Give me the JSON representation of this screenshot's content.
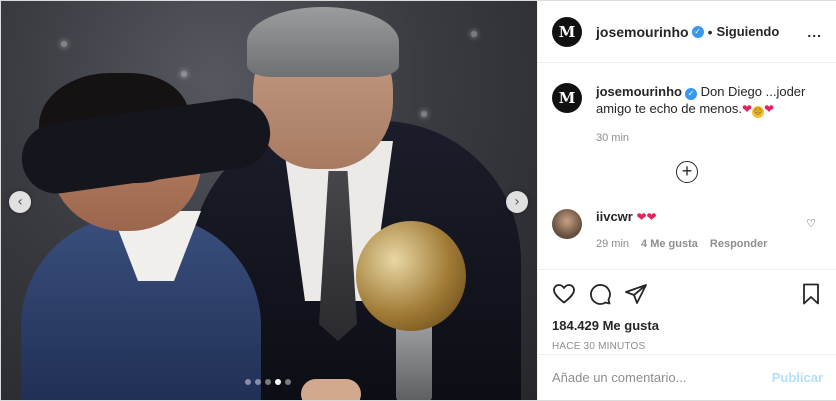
{
  "post": {
    "author": {
      "username": "josemourinho",
      "avatar_initial": "M",
      "verified_icon": "verified-badge-icon",
      "follow_status": "Siguiendo",
      "separator": "•",
      "more_label": "..."
    },
    "media": {
      "slide_count": 5,
      "active_slide": 4,
      "prev_glyph": "‹",
      "next_glyph": "›"
    },
    "caption": {
      "username": "josemourinho",
      "text": "Don Diego ...joder amigo te echo de menos.",
      "time": "30 min"
    },
    "load_more_glyph": "+",
    "comments": [
      {
        "username": "iivcwr",
        "time": "29 min",
        "likes": "4 Me gusta",
        "reply_label": "Responder"
      }
    ],
    "actions": {
      "likes_count": "184.429 Me gusta",
      "posted_ago": "HACE 30 MINUTOS"
    },
    "add_comment": {
      "placeholder": "Añade un comentario...",
      "publish_label": "Publicar"
    }
  },
  "colors": {
    "verified": "#3897f0",
    "heart": "#e0245e",
    "publish_disabled": "#b2dffc",
    "muted_text": "#8e8e8e"
  }
}
